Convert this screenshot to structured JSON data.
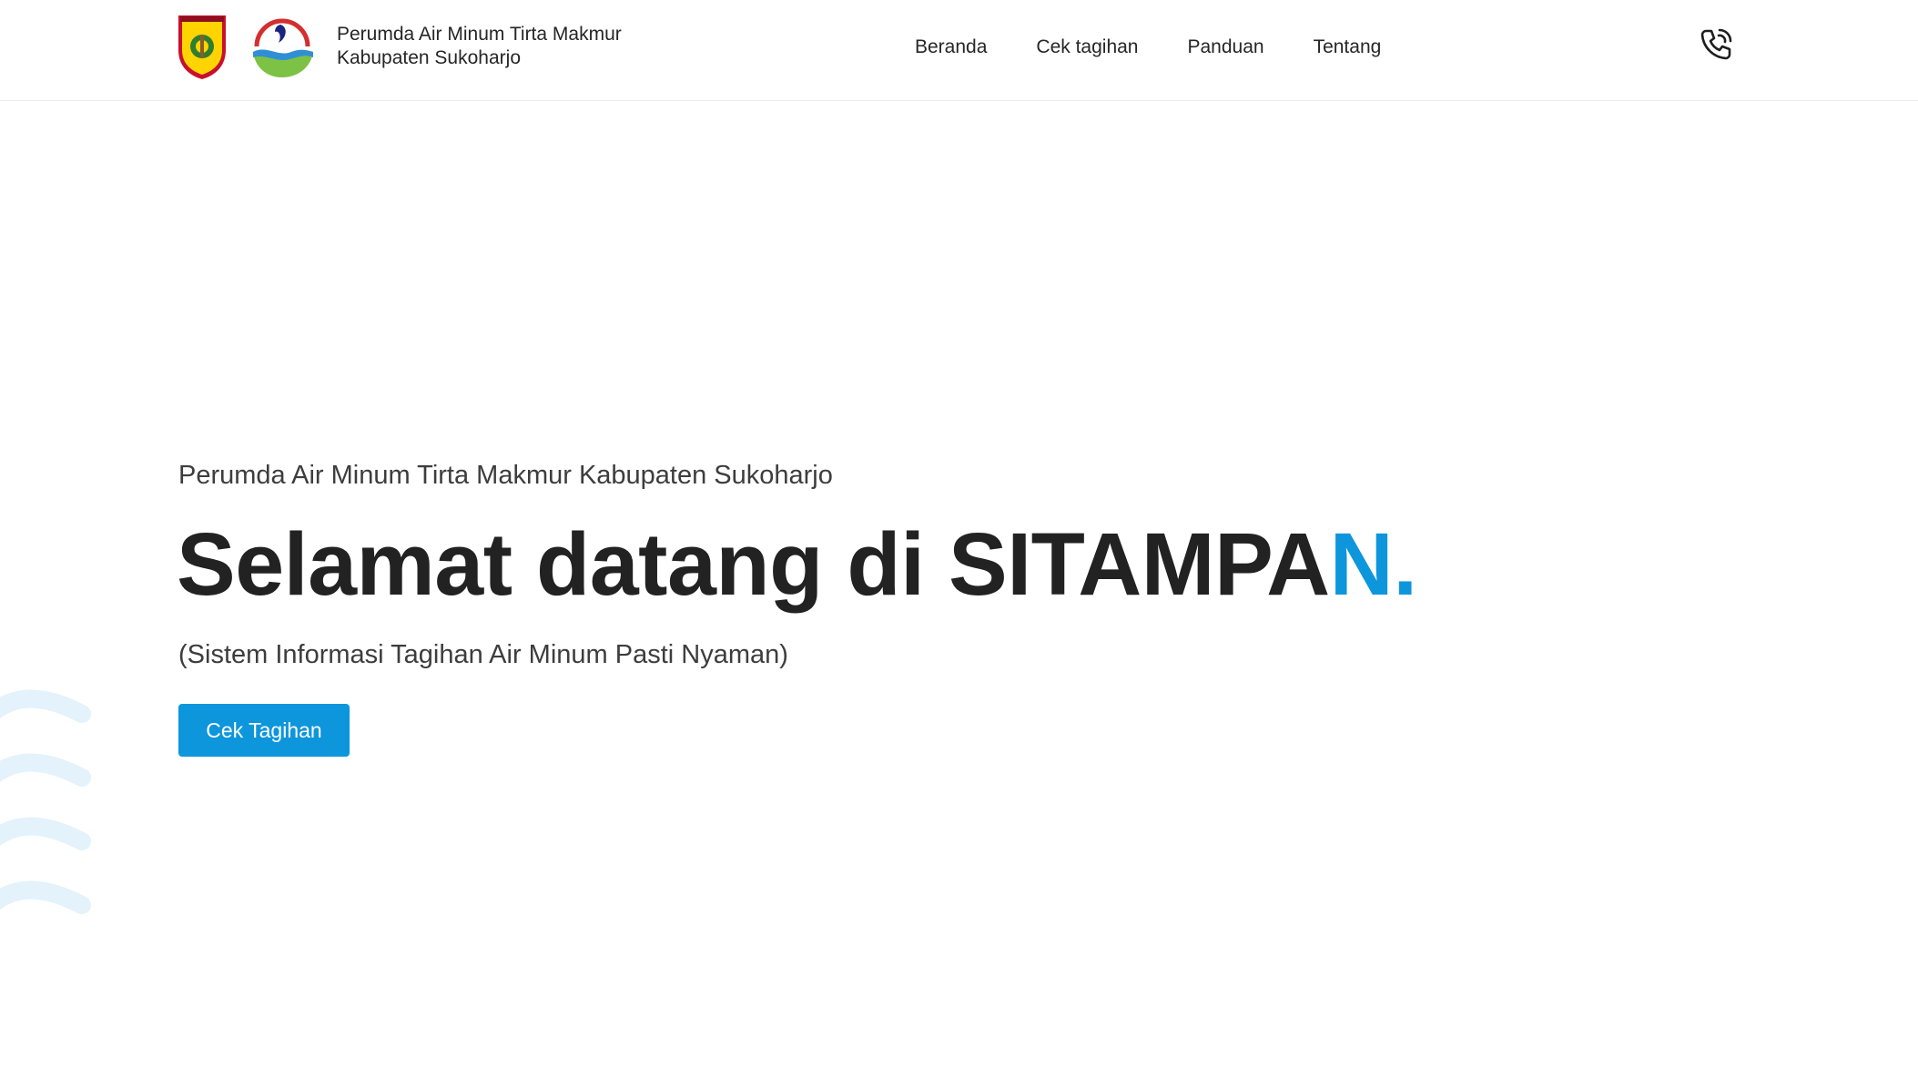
{
  "header": {
    "logos": {
      "regency_seal_icon": "sukoharjo-regency-seal",
      "pdam_logo_icon": "tirta-makmur-logo"
    },
    "org_name_line1": "Perumda Air Minum Tirta Makmur",
    "org_name_line2": "Kabupaten Sukoharjo",
    "nav": [
      {
        "label": "Beranda"
      },
      {
        "label": "Cek tagihan"
      },
      {
        "label": "Panduan"
      },
      {
        "label": "Tentang"
      }
    ],
    "contact_icon": "phone-call-icon"
  },
  "hero": {
    "subtitle": "Perumda Air Minum Tirta Makmur Kabupaten Sukoharjo",
    "title_main": "Selamat datang di SITAMPA",
    "title_accent": "N.",
    "description": "(Sistem Informasi Tagihan Air Minum Pasti Nyaman)",
    "cta_label": "Cek Tagihan"
  },
  "colors": {
    "accent": "#0e96dc",
    "text_dark": "#222222",
    "wave": "#e3f2fb"
  }
}
